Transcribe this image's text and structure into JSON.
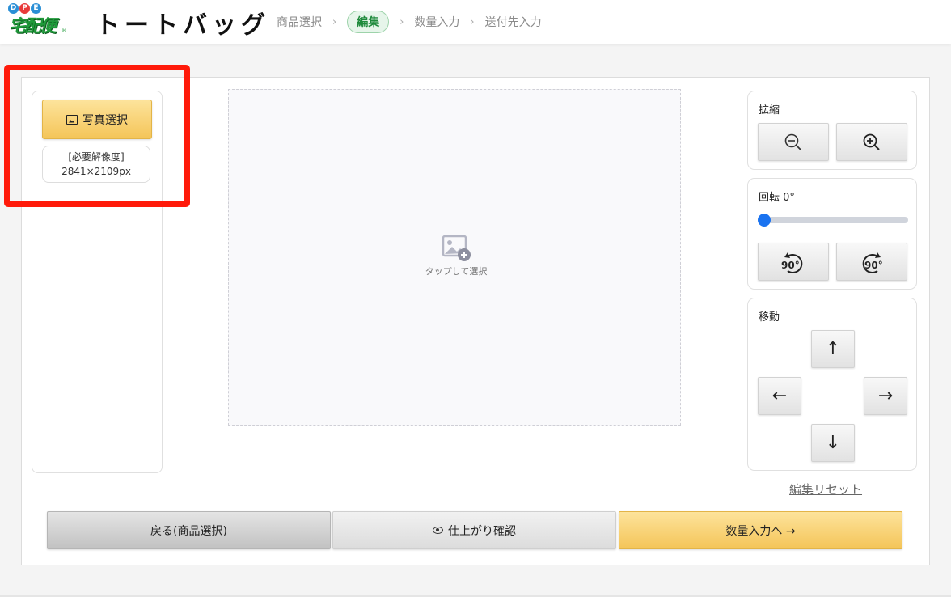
{
  "header": {
    "logo_letters": [
      "D",
      "P",
      "E"
    ],
    "logo_letter_colors": [
      "#2a8fd6",
      "#e83b3b",
      "#2a8fd6"
    ],
    "logo_main": "宅配便",
    "logo_mark": "®",
    "title": "トートバッグ",
    "breadcrumb": [
      "商品選択",
      "編集",
      "数量入力",
      "送付先入力"
    ],
    "breadcrumb_active_index": 1,
    "separator": "›"
  },
  "left_panel": {
    "photo_button_label": "写真選択",
    "photo_button_icon": "image-icon",
    "resolution_label": "[必要解像度]",
    "resolution_value": "2841×2109px"
  },
  "canvas": {
    "placeholder_text": "タップして選択",
    "placeholder_icon": "add-image-icon"
  },
  "controls": {
    "zoom": {
      "label": "拡縮",
      "zoom_out_icon": "zoom-out-icon",
      "zoom_in_icon": "zoom-in-icon"
    },
    "rotate": {
      "label": "回転 0°",
      "slider_value": 0,
      "rotate_left_label": "90°",
      "rotate_right_label": "90°"
    },
    "move": {
      "label": "移動",
      "up": "↑",
      "left": "←",
      "right": "→",
      "down": "↓"
    },
    "reset_label": "編集リセット"
  },
  "footer": {
    "back_label": "戻る(商品選択)",
    "check_label": "仕上がり確認",
    "next_label": "数量入力へ →"
  },
  "colors": {
    "accent_yellow": "#f4c559",
    "brand_green": "#1f9a3a",
    "highlight_red": "#ff1a0a",
    "slider_blue": "#1a73f0"
  }
}
